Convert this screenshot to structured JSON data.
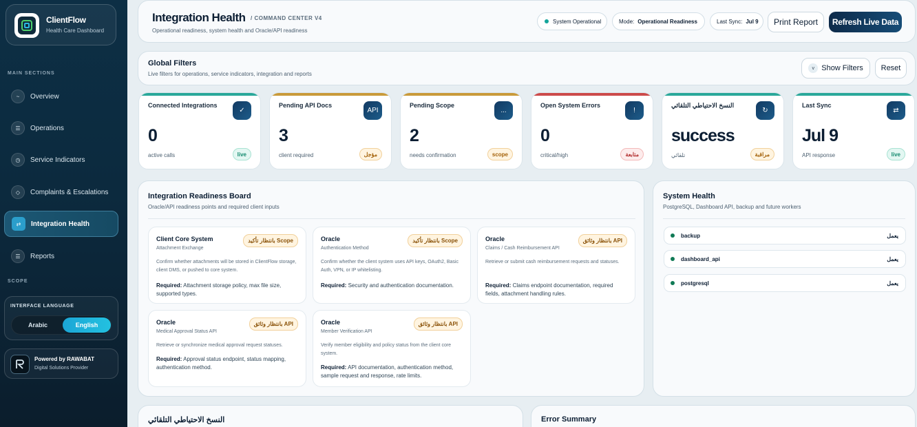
{
  "sidebar": {
    "brand_title": "ClientFlow",
    "brand_sub": "Health Care Dashboard",
    "main_sections_label": "MAIN SECTIONS",
    "items": [
      {
        "label": "Overview",
        "icon": "~"
      },
      {
        "label": "Operations",
        "icon": "☰"
      },
      {
        "label": "Service Indicators",
        "icon": "◷"
      },
      {
        "label": "Complaints & Escalations",
        "icon": "◇"
      },
      {
        "label": "Integration Health",
        "icon": "⇄"
      },
      {
        "label": "Reports",
        "icon": "☰"
      }
    ],
    "active_item": "Integration Health",
    "scope_label": "SCOPE",
    "language": {
      "title": "INTERFACE LANGUAGE",
      "arabic": "Arabic",
      "english": "English",
      "selected": "English"
    },
    "powered": {
      "title": "Powered by RAWABAT",
      "sub": "Digital Solutions Provider"
    }
  },
  "header": {
    "title": "Integration Health",
    "badge": "/ COMMAND CENTER V4",
    "subtitle": "Operational readiness, system health and Oracle/API readiness",
    "status": "System Operational",
    "mode_label": "Mode:",
    "mode_value": "Operational Readiness",
    "sync_label": "Last Sync:",
    "sync_value": "Jul 9",
    "print_label": "Print Report",
    "refresh_label": "Refresh Live Data"
  },
  "filters": {
    "title": "Global Filters",
    "subtitle": "Live filters for operations, service indicators, integration and reports",
    "show_label": "Show Filters",
    "reset_label": "Reset"
  },
  "kpis": [
    {
      "title": "Connected Integrations",
      "icon": "✓",
      "value": "0",
      "foot": "active calls",
      "tag": "live",
      "accent": "#2aa89a"
    },
    {
      "title": "Pending API Docs",
      "icon": "API",
      "value": "3",
      "foot": "client required",
      "tag": "مؤجل",
      "accent": "#c99a3a"
    },
    {
      "title": "Pending Scope",
      "icon": "...",
      "value": "2",
      "foot": "needs confirmation",
      "tag": "scope",
      "accent": "#c99a3a"
    },
    {
      "title": "Open System Errors",
      "icon": "!",
      "value": "0",
      "foot": "critical/high",
      "tag": "متابعة",
      "accent": "#cc4a4a"
    },
    {
      "title": "النسخ الاحتياطي التلقائي",
      "icon": "↻",
      "value": "success",
      "foot": "تلقائي",
      "tag": "مراقبة",
      "accent": "#2aa89a"
    },
    {
      "title": "Last Sync",
      "icon": "⇄",
      "value": "Jul 9",
      "foot": "API response",
      "tag": "live",
      "accent": "#2aa89a"
    }
  ],
  "board": {
    "title": "Integration Readiness Board",
    "subtitle": "Oracle/API readiness points and required client inputs",
    "required_label": "Required:",
    "cards": [
      {
        "title": "Client Core System",
        "sub": "Attachment Exchange",
        "tag": "بانتظار تأكيد Scope",
        "desc": "Confirm whether attachments will be stored in ClientFlow storage, client DMS, or pushed to core system.",
        "req": "Attachment storage policy, max file size, supported types."
      },
      {
        "title": "Oracle",
        "sub": "Authentication Method",
        "tag": "بانتظار تأكيد Scope",
        "desc": "Confirm whether the client system uses API keys, OAuth2, Basic Auth, VPN, or IP whitelisting.",
        "req": "Security and authentication documentation."
      },
      {
        "title": "Oracle",
        "sub": "Claims / Cash Reimbursement API",
        "tag": "بانتظار وثائق API",
        "desc": "Retrieve or submit cash reimbursement requests and statuses.",
        "req": "Claims endpoint documentation, required fields, attachment handling rules."
      },
      {
        "title": "Oracle",
        "sub": "Medical Approval Status API",
        "tag": "بانتظار وثائق API",
        "desc": "Retrieve or synchronize medical approval request statuses.",
        "req": "Approval status endpoint, status mapping, authentication method."
      },
      {
        "title": "Oracle",
        "sub": "Member Verification API",
        "tag": "بانتظار وثائق API",
        "desc": "Verify member eligibility and policy status from the client core system.",
        "req": "API documentation, authentication method, sample request and response, rate limits."
      }
    ]
  },
  "health": {
    "title": "System Health",
    "subtitle": "PostgreSQL, Dashboard API, backup and future workers",
    "rows": [
      {
        "name": "backup",
        "status": "يعمل"
      },
      {
        "name": "dashboard_api",
        "status": "يعمل"
      },
      {
        "name": "postgresql",
        "status": "يعمل"
      }
    ]
  },
  "bottom": {
    "backup_title": "النسخ الاحتياطي التلقائي",
    "error_title": "Error Summary"
  }
}
